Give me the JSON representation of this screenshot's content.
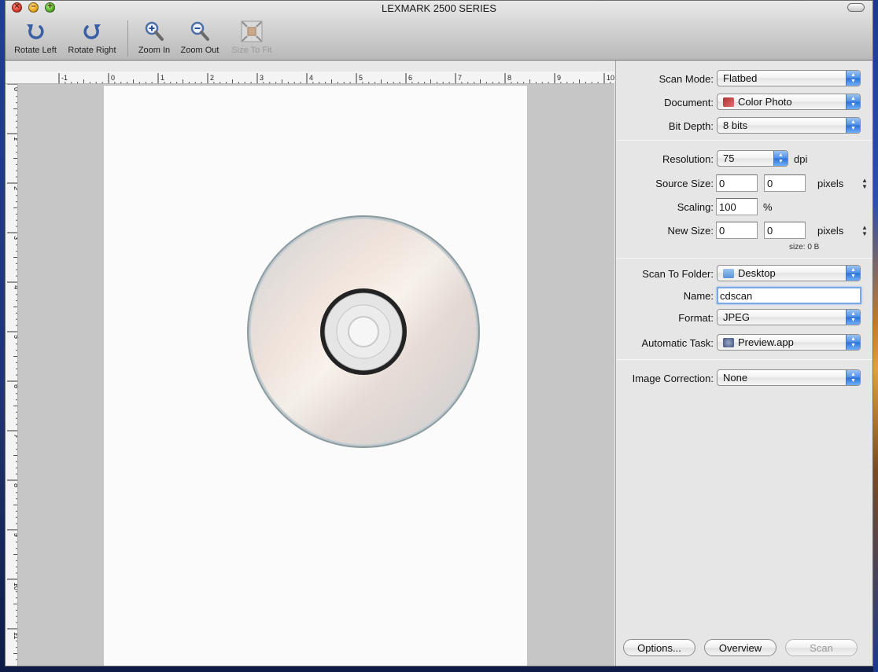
{
  "window": {
    "title": "LEXMARK 2500 SERIES"
  },
  "toolbar": {
    "rotate_left": "Rotate Left",
    "rotate_right": "Rotate Right",
    "zoom_in": "Zoom In",
    "zoom_out": "Zoom Out",
    "size_to_fit": "Size To Fit"
  },
  "ruler": {
    "h_labels": [
      "-1",
      "0",
      "1",
      "2",
      "3",
      "4",
      "5",
      "6",
      "7",
      "8",
      "9",
      "10"
    ],
    "v_labels": [
      "0",
      "1",
      "2",
      "3",
      "4",
      "5",
      "6",
      "7",
      "8",
      "9",
      "10",
      "11"
    ]
  },
  "settings": {
    "scan_mode_label": "Scan Mode:",
    "scan_mode_value": "Flatbed",
    "document_label": "Document:",
    "document_value": "Color Photo",
    "bit_depth_label": "Bit Depth:",
    "bit_depth_value": "8 bits",
    "resolution_label": "Resolution:",
    "resolution_value": "75",
    "resolution_unit": "dpi",
    "source_size_label": "Source Size:",
    "source_w": "0",
    "source_h": "0",
    "source_unit": "pixels",
    "scaling_label": "Scaling:",
    "scaling_value": "100",
    "scaling_unit": "%",
    "new_size_label": "New Size:",
    "new_w": "0",
    "new_h": "0",
    "new_unit": "pixels",
    "size_info": "size:  0 B",
    "folder_label": "Scan To Folder:",
    "folder_value": "Desktop",
    "name_label": "Name:",
    "name_value": "cdscan",
    "format_label": "Format:",
    "format_value": "JPEG",
    "task_label": "Automatic Task:",
    "task_value": "Preview.app",
    "correction_label": "Image Correction:",
    "correction_value": "None"
  },
  "buttons": {
    "options": "Options...",
    "overview": "Overview",
    "scan": "Scan"
  },
  "colors": {
    "popup_arrow": "#2c6fd4",
    "focus_ring": "#7aa8e8"
  }
}
